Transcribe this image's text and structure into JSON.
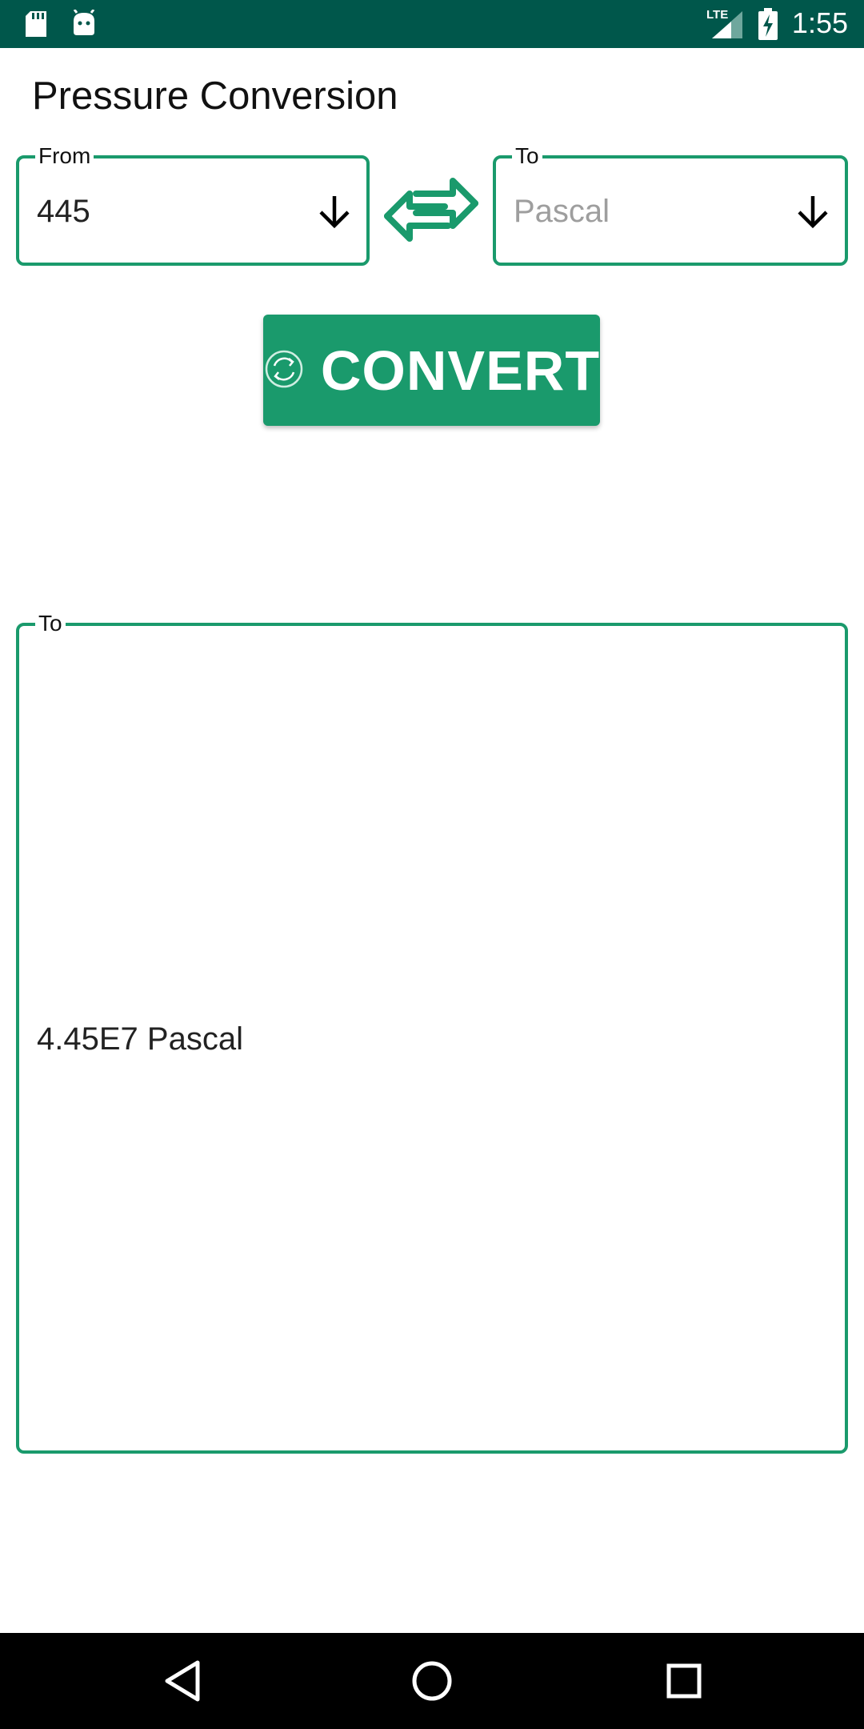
{
  "status_bar": {
    "time": "1:55",
    "network": "LTE",
    "icons": [
      "sd-card-icon",
      "android-icon",
      "signal-icon",
      "battery-charging-icon"
    ]
  },
  "app": {
    "title": "Pressure Conversion"
  },
  "from_field": {
    "label": "From",
    "value": "445"
  },
  "to_field": {
    "label": "To",
    "placeholder": "Pascal"
  },
  "convert_button": {
    "label": "CONVERT"
  },
  "result": {
    "label": "To",
    "text": "4.45E7 Pascal"
  },
  "colors": {
    "accent": "#1a9a6c",
    "status_bar": "#00574b",
    "nav_bar": "#000000"
  },
  "nav_bar": {
    "icons": [
      "back-icon",
      "home-icon",
      "recents-icon"
    ]
  }
}
